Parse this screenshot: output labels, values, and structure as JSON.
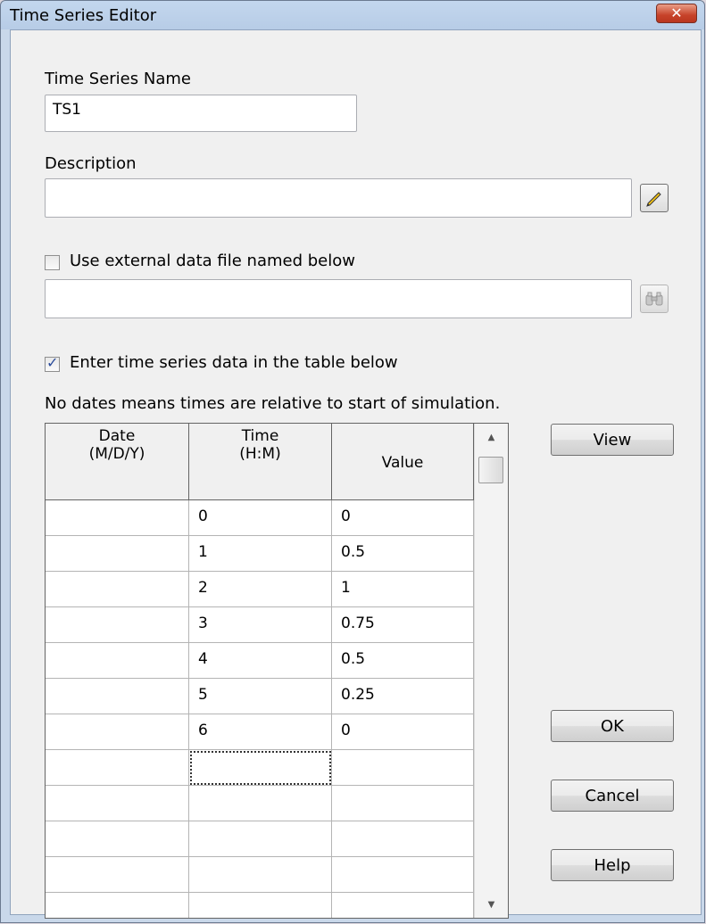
{
  "window": {
    "title": "Time Series Editor",
    "close_label": "✕"
  },
  "name_field": {
    "label": "Time Series Name",
    "value": "TS1"
  },
  "description_field": {
    "label": "Description",
    "value": "",
    "edit_icon": "pencil-icon"
  },
  "external_file": {
    "label": "Use external data file named below",
    "checked": false,
    "value": "",
    "browse_icon": "binoculars-icon"
  },
  "table_option": {
    "label": "Enter time series data in the table below",
    "checked": true
  },
  "note": "No dates means times are relative to start of simulation.",
  "table": {
    "headers": [
      {
        "line1": "Date",
        "line2": "(M/D/Y)"
      },
      {
        "line1": "Time",
        "line2": "(H:M)"
      },
      {
        "line1": "",
        "line2": "Value"
      }
    ],
    "rows": [
      {
        "date": "",
        "time": "0",
        "value": "0"
      },
      {
        "date": "",
        "time": "1",
        "value": "0.5"
      },
      {
        "date": "",
        "time": "2",
        "value": "1"
      },
      {
        "date": "",
        "time": "3",
        "value": "0.75"
      },
      {
        "date": "",
        "time": "4",
        "value": "0.5"
      },
      {
        "date": "",
        "time": "5",
        "value": "0.25"
      },
      {
        "date": "",
        "time": "6",
        "value": "0"
      },
      {
        "date": "",
        "time": "",
        "value": ""
      },
      {
        "date": "",
        "time": "",
        "value": ""
      },
      {
        "date": "",
        "time": "",
        "value": ""
      },
      {
        "date": "",
        "time": "",
        "value": ""
      },
      {
        "date": "",
        "time": "",
        "value": ""
      }
    ],
    "focused_row": 7
  },
  "buttons": {
    "view": "View",
    "ok": "OK",
    "cancel": "Cancel",
    "help": "Help"
  }
}
